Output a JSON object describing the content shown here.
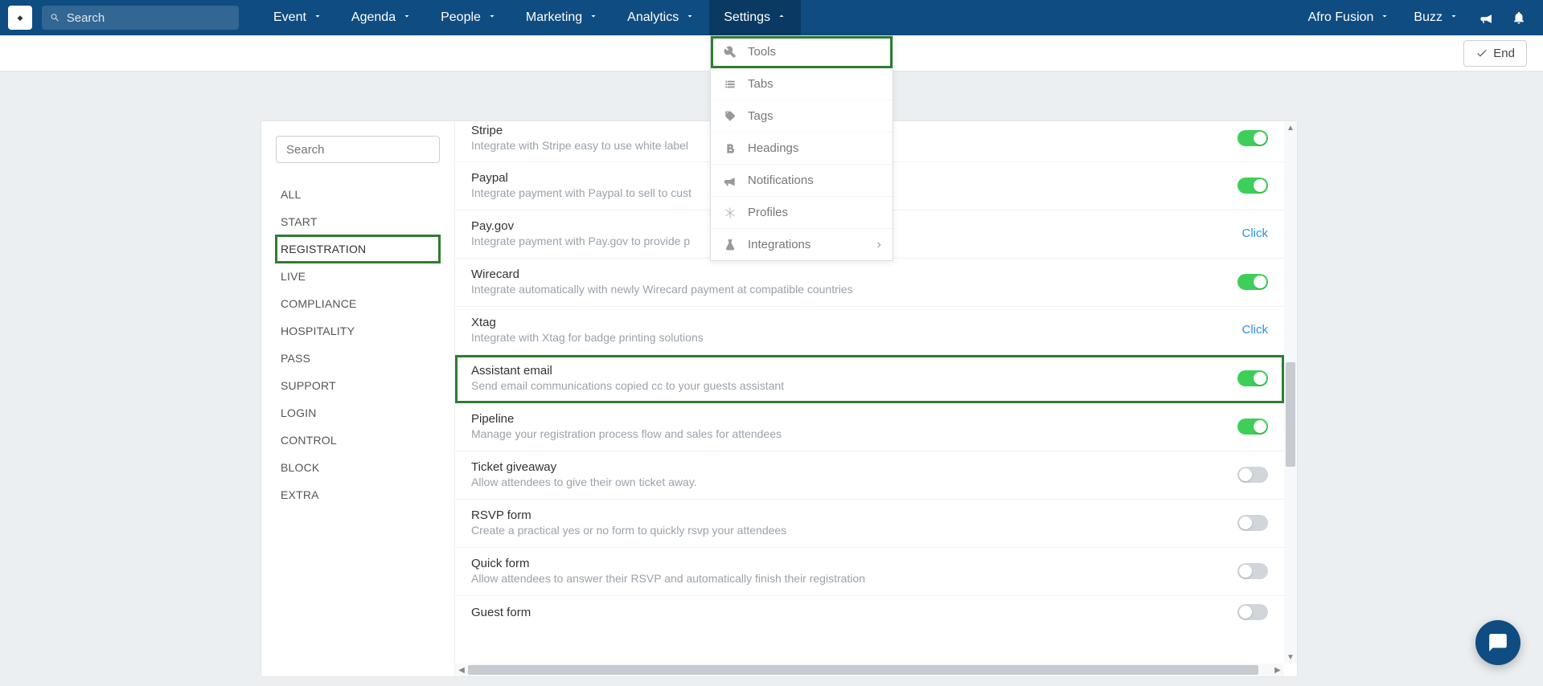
{
  "topnav": {
    "search_placeholder": "Search",
    "items": [
      {
        "label": "Event"
      },
      {
        "label": "Agenda"
      },
      {
        "label": "People"
      },
      {
        "label": "Marketing"
      },
      {
        "label": "Analytics"
      },
      {
        "label": "Settings",
        "open": true
      }
    ],
    "right": {
      "account": "Afro Fusion",
      "workspace": "Buzz"
    }
  },
  "subbar": {
    "end_label": "End"
  },
  "dropdown": {
    "items": [
      {
        "label": "Tools",
        "icon": "wrench",
        "highlighted": true
      },
      {
        "label": "Tabs",
        "icon": "list"
      },
      {
        "label": "Tags",
        "icon": "tag"
      },
      {
        "label": "Headings",
        "icon": "bold"
      },
      {
        "label": "Notifications",
        "icon": "bullhorn"
      },
      {
        "label": "Profiles",
        "icon": "snowflake"
      },
      {
        "label": "Integrations",
        "icon": "flask",
        "submenu": true
      }
    ]
  },
  "sidebar": {
    "search_placeholder": "Search",
    "items": [
      {
        "label": "ALL"
      },
      {
        "label": "START"
      },
      {
        "label": "REGISTRATION",
        "active": true
      },
      {
        "label": "LIVE"
      },
      {
        "label": "COMPLIANCE"
      },
      {
        "label": "HOSPITALITY"
      },
      {
        "label": "PASS"
      },
      {
        "label": "SUPPORT"
      },
      {
        "label": "LOGIN"
      },
      {
        "label": "CONTROL"
      },
      {
        "label": "BLOCK"
      },
      {
        "label": "EXTRA"
      }
    ]
  },
  "settings_rows": [
    {
      "title": "Stripe",
      "desc": "Integrate with Stripe easy to use white label",
      "control": "toggle",
      "on": true
    },
    {
      "title": "Paypal",
      "desc": "Integrate payment with Paypal to sell to cust",
      "control": "toggle",
      "on": true
    },
    {
      "title": "Pay.gov",
      "desc": "Integrate payment with Pay.gov to provide p",
      "control": "click"
    },
    {
      "title": "Wirecard",
      "desc": "Integrate automatically with newly Wirecard payment at compatible countries",
      "control": "toggle",
      "on": true
    },
    {
      "title": "Xtag",
      "desc": "Integrate with Xtag for badge printing solutions",
      "control": "click"
    },
    {
      "title": "Assistant email",
      "desc": "Send email communications copied cc to your guests assistant",
      "control": "toggle",
      "on": true,
      "highlighted": true
    },
    {
      "title": "Pipeline",
      "desc": "Manage your registration process flow and sales for attendees",
      "control": "toggle",
      "on": true
    },
    {
      "title": "Ticket giveaway",
      "desc": "Allow attendees to give their own ticket away.",
      "control": "toggle",
      "on": false
    },
    {
      "title": "RSVP form",
      "desc": "Create a practical yes or no form to quickly rsvp your attendees",
      "control": "toggle",
      "on": false
    },
    {
      "title": "Quick form",
      "desc": "Allow attendees to answer their RSVP and automatically finish their registration",
      "control": "toggle",
      "on": false
    },
    {
      "title": "Guest form",
      "desc": "",
      "control": "toggle",
      "on": false
    }
  ],
  "click_label": "Click"
}
